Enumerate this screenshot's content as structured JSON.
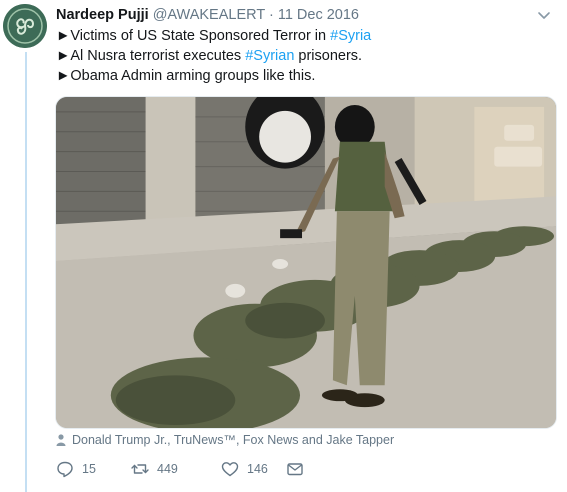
{
  "tweet": {
    "author_name": "Nardeep Pujji",
    "handle": "@AWAKEALERT",
    "separator": "·",
    "date": "11 Dec 2016",
    "lines": [
      {
        "prefix": "►Victims of US State Sponsored Terror in ",
        "hashtag": "#Syria",
        "suffix": ""
      },
      {
        "prefix": "►Al Nusra terrorist executes ",
        "hashtag": "#Syrian",
        "suffix": " prisoners."
      },
      {
        "prefix": "►Obama Admin arming groups like this.",
        "hashtag": "",
        "suffix": ""
      }
    ],
    "tagged_users": "Donald Trump Jr., TruNews™, Fox News and Jake Tapper",
    "counts": {
      "replies": "15",
      "retweets": "449",
      "likes": "146"
    }
  },
  "colors": {
    "link": "#1da1f2",
    "secondary_text": "#657786",
    "thread_line": "#c4dff3"
  },
  "icons": [
    "chevron-down-icon",
    "person-icon",
    "reply-icon",
    "retweet-icon",
    "like-icon",
    "dm-icon"
  ]
}
